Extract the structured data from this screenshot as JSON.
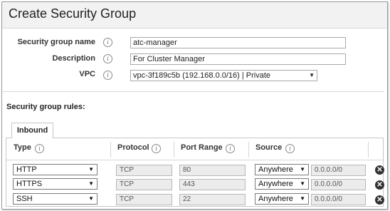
{
  "dialog": {
    "title": "Create Security Group"
  },
  "form": {
    "name_label": "Security group name",
    "name_value": "atc-manager",
    "description_label": "Description",
    "description_value": "For Cluster Manager",
    "vpc_label": "VPC",
    "vpc_value": "vpc-3f189c5b (192.168.0.0/16) | Private",
    "info_glyph": "i"
  },
  "rules": {
    "section_label": "Security group rules:",
    "active_tab": "Inbound",
    "columns": {
      "type": "Type",
      "protocol": "Protocol",
      "port_range": "Port Range",
      "source": "Source"
    },
    "rows": [
      {
        "type": "HTTP",
        "protocol": "TCP",
        "port_range": "80",
        "source": "Anywhere",
        "cidr": "0.0.0.0/0"
      },
      {
        "type": "HTTPS",
        "protocol": "TCP",
        "port_range": "443",
        "source": "Anywhere",
        "cidr": "0.0.0.0/0"
      },
      {
        "type": "SSH",
        "protocol": "TCP",
        "port_range": "22",
        "source": "Anywhere",
        "cidr": "0.0.0.0/0"
      }
    ]
  },
  "icons": {
    "info": "info-icon",
    "dropdown": "chevron-down-icon",
    "remove": "remove-circle-icon"
  }
}
